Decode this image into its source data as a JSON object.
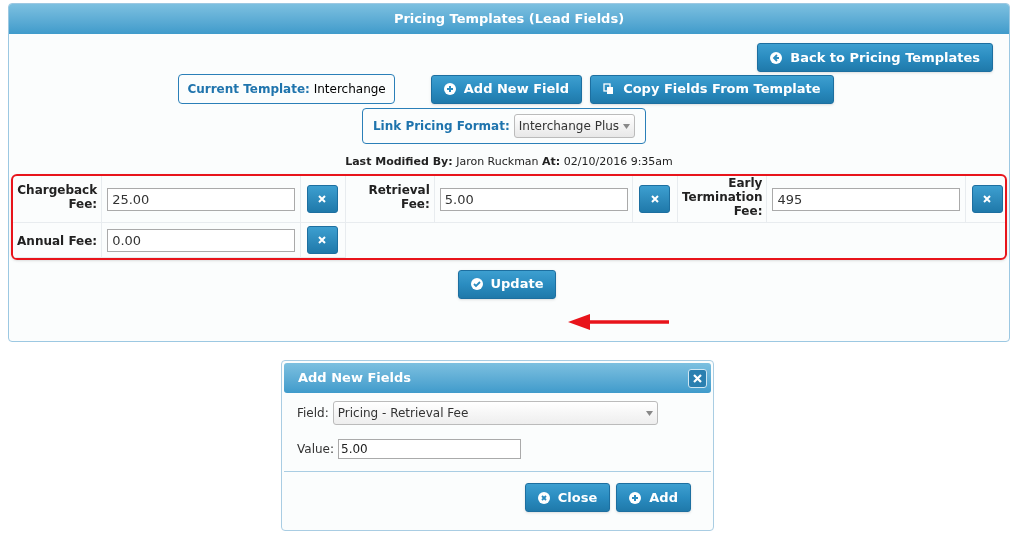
{
  "panel": {
    "title": "Pricing Templates (Lead Fields)",
    "back_button": "Back to Pricing Templates",
    "current_template": {
      "label": "Current Template:",
      "value": "Interchange"
    },
    "add_button": "Add New Field",
    "copy_button": "Copy Fields From Template",
    "link_format": {
      "label": "Link Pricing Format:",
      "value": "Interchange Plus"
    },
    "last_modified": "**Last Modified By:** Jaron Ruckman **At:** 02/10/2016 9:35am",
    "fields": [
      {
        "label": "Chargeback Fee:",
        "value": "25.00"
      },
      {
        "label": "Retrieval Fee:",
        "value": "5.00"
      },
      {
        "label": "Early Termination Fee:",
        "value": "495"
      },
      {
        "label": "Annual Fee:",
        "value": "0.00"
      }
    ],
    "update_button": "Update"
  },
  "dialog": {
    "title": "Add New Fields",
    "field_label": "Field:",
    "field_value": "Pricing - Retrieval Fee",
    "value_label": "Value:",
    "value": "5.00",
    "buttons": [
      "Close",
      "Add"
    ]
  }
}
